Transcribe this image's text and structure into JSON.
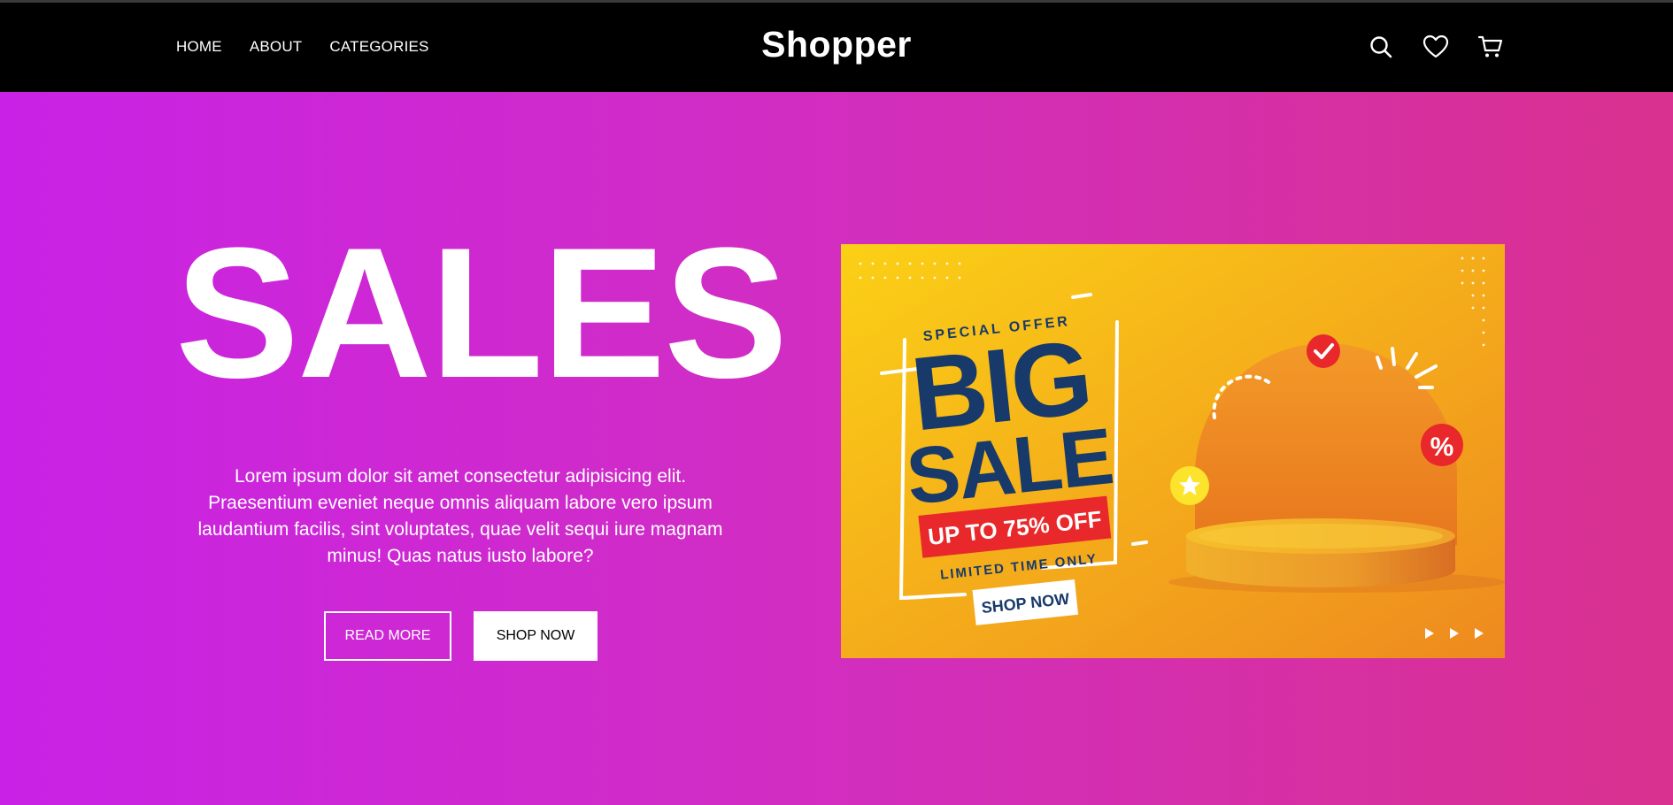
{
  "nav": {
    "links": [
      "HOME",
      "ABOUT",
      "CATEGORIES"
    ],
    "brand": "Shopper",
    "icons": [
      "search-icon",
      "heart-icon",
      "cart-icon"
    ]
  },
  "hero": {
    "title": "SALES",
    "description": "Lorem ipsum dolor sit amet consectetur adipisicing elit. Praesentium eveniet neque omnis aliquam labore vero ipsum laudantium facilis, sint voluptates, quae velit sequi iure magnam minus! Quas natus iusto labore?",
    "read_more_label": "READ MORE",
    "shop_now_label": "SHOP NOW"
  },
  "banner": {
    "special_offer": "SPECIAL OFFER",
    "big": "BIG",
    "sale": "SALE",
    "discount": "UP TO 75% OFF",
    "limited": "LIMITED TIME ONLY",
    "cta": "SHOP NOW",
    "percent_symbol": "%",
    "colors": {
      "yellow": "#fbd016",
      "orange": "#ee8a1f",
      "navy": "#183a6a",
      "red": "#e8282a"
    }
  },
  "colors": {
    "navbar": "#000000",
    "hero_start": "#c922e6",
    "hero_end": "#d9318f"
  }
}
